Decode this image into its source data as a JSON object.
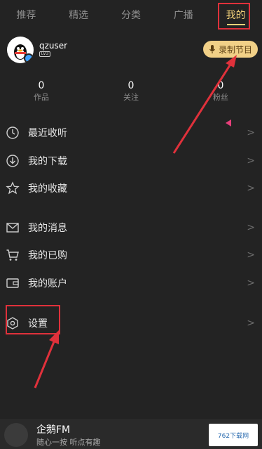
{
  "tabs": [
    {
      "label": "推荐"
    },
    {
      "label": "精选"
    },
    {
      "label": "分类"
    },
    {
      "label": "广播"
    },
    {
      "label": "我的",
      "active": true
    }
  ],
  "profile": {
    "username": "qzuser",
    "level": "LV3",
    "record_button": "录制节目"
  },
  "stats": [
    {
      "value": "0",
      "label": "作品"
    },
    {
      "value": "0",
      "label": "关注"
    },
    {
      "value": "0",
      "label": "粉丝"
    }
  ],
  "menu": [
    {
      "label": "最近收听",
      "icon": "clock-icon"
    },
    {
      "label": "我的下载",
      "icon": "download-icon"
    },
    {
      "label": "我的收藏",
      "icon": "star-icon"
    },
    {
      "label": "我的消息",
      "icon": "mail-icon"
    },
    {
      "label": "我的已购",
      "icon": "cart-icon"
    },
    {
      "label": "我的账户",
      "icon": "wallet-icon"
    },
    {
      "label": "设置",
      "icon": "settings-icon"
    }
  ],
  "arrow_glyph": ">",
  "player": {
    "title": "企鹅FM",
    "subtitle": "随心一按 听点有趣"
  },
  "watermark": "762下载网",
  "colors": {
    "accent": "#f3d27a",
    "background": "#232323",
    "highlight": "#e0313b",
    "marker": "#e83f7b"
  }
}
